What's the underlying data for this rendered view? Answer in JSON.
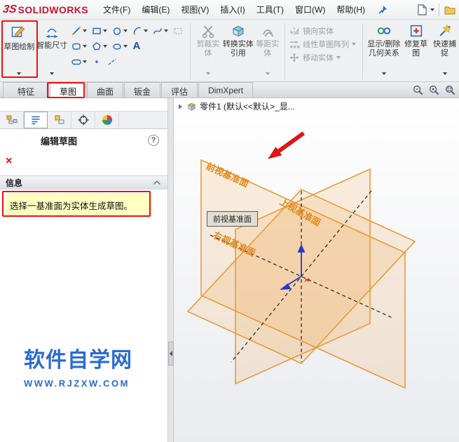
{
  "titlebar": {
    "logo_mark": "3S",
    "brand": "SOLIDWORKS",
    "menus": [
      {
        "label": "文件(F)"
      },
      {
        "label": "编辑(E)"
      },
      {
        "label": "视图(V)"
      },
      {
        "label": "插入(I)"
      },
      {
        "label": "工具(T)"
      },
      {
        "label": "窗口(W)"
      },
      {
        "label": "帮助(H)"
      }
    ]
  },
  "ribbon": {
    "sketch": {
      "label": "草图绘制"
    },
    "smart_dim": {
      "label": "智能尺寸"
    },
    "trim": {
      "label": "剪裁实体"
    },
    "convert": {
      "label": "转换实体引用"
    },
    "offset": {
      "label": "等距实体"
    },
    "mirror": {
      "label": "镜向实体"
    },
    "linear_pattern": {
      "label": "线性草图阵列"
    },
    "move": {
      "label": "移动实体"
    },
    "relations": {
      "label": "显示/删除几何关系"
    },
    "repair": {
      "label": "修复草图"
    },
    "quick_snap": {
      "label": "快速捕捉"
    },
    "text_tool": "A"
  },
  "tabs": {
    "active": "草图",
    "items": [
      {
        "label": "特征"
      },
      {
        "label": "草图"
      },
      {
        "label": "曲面"
      },
      {
        "label": "钣金"
      },
      {
        "label": "评估"
      },
      {
        "label": "DimXpert"
      }
    ]
  },
  "panel": {
    "title": "编辑草图",
    "help_glyph": "?",
    "close_glyph": "×",
    "info_header": "信息",
    "message": "选择一基准面为实体生成草图。",
    "watermark_title": "软件自学网",
    "watermark_url": "WWW.RJZXW.COM"
  },
  "viewport": {
    "tree_item": "零件1 (默认<<默认>_显...",
    "tooltip": "前视基准面",
    "planes": {
      "front": "前视基准面",
      "top": "上视基准面",
      "right": "右视基准面"
    }
  },
  "colors": {
    "annotation_red": "#ee1111",
    "plane_orange": "#e8952f",
    "watermark_blue": "#2a6bd2",
    "message_yellow": "#ffffc2",
    "brand_red": "#cf1430"
  }
}
